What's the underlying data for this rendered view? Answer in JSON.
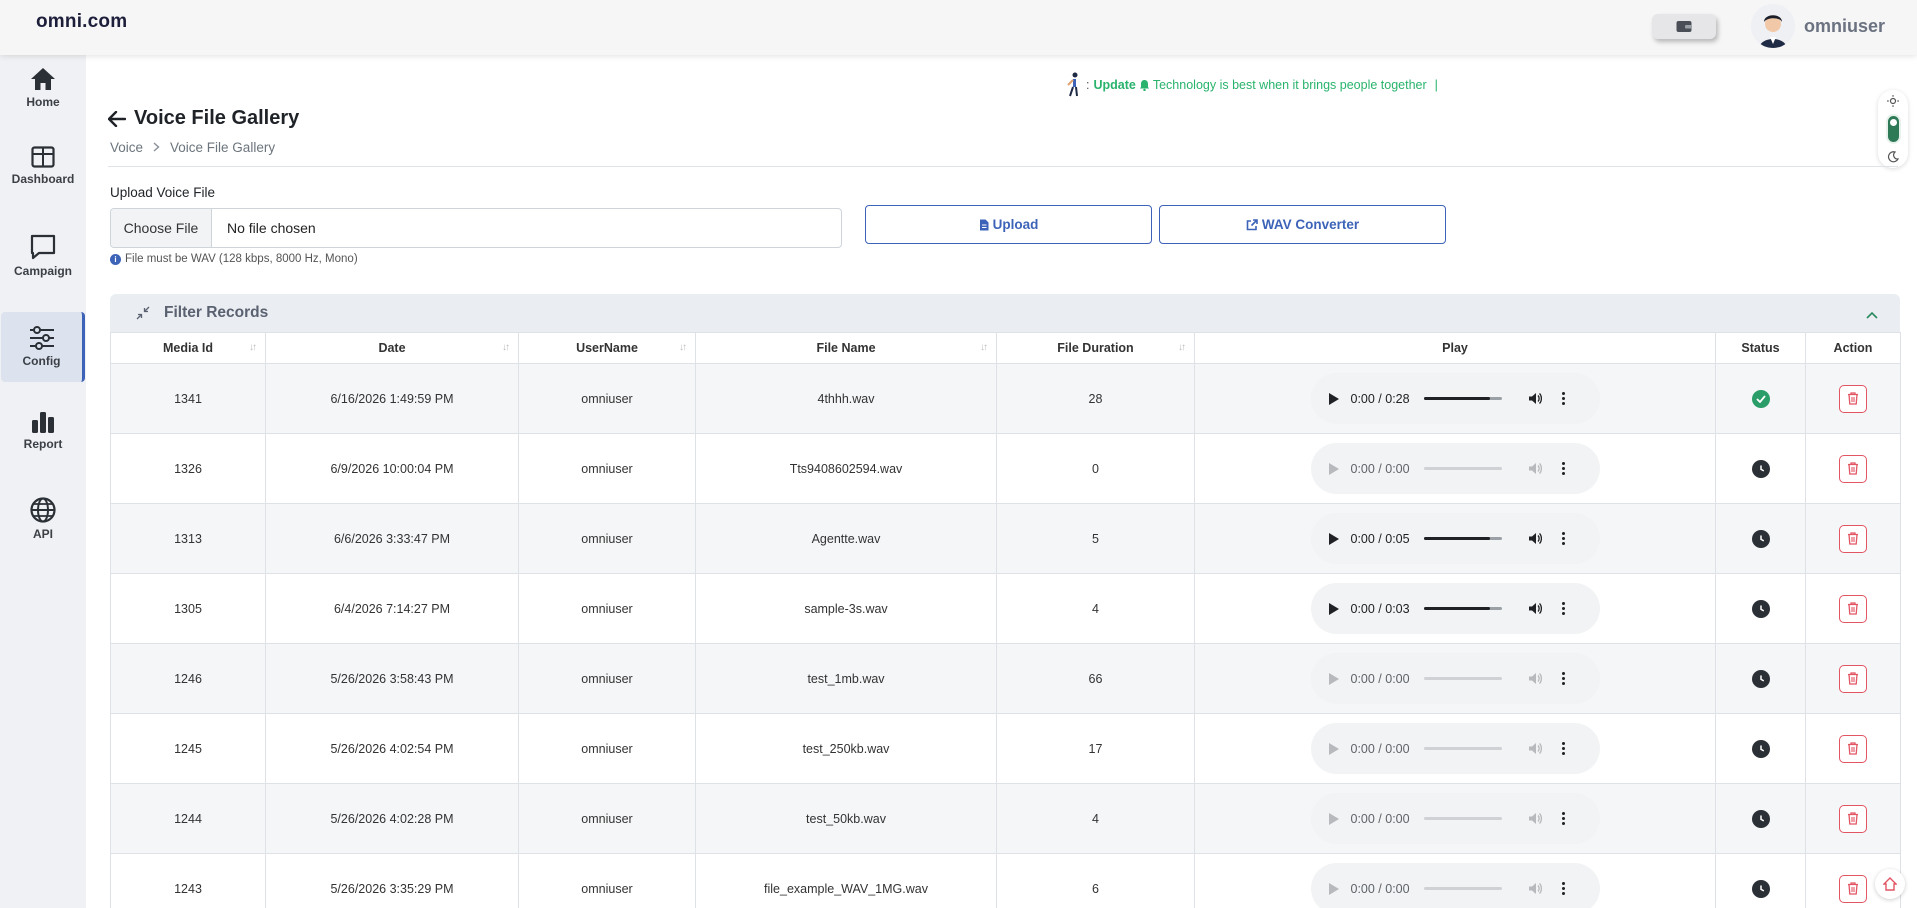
{
  "brand": "omni.com",
  "user": {
    "name": "omniuser"
  },
  "sidebar": {
    "items": [
      {
        "label": "Home",
        "icon": "home-icon"
      },
      {
        "label": "Dashboard",
        "icon": "dashboard-icon"
      },
      {
        "label": "Campaign",
        "icon": "campaign-icon"
      },
      {
        "label": "Config",
        "icon": "config-icon",
        "active": true
      },
      {
        "label": "Report",
        "icon": "report-icon"
      },
      {
        "label": "API",
        "icon": "globe-icon"
      }
    ]
  },
  "ticker": {
    "prefix": ":",
    "label": "Update",
    "message": "Technology is best when it brings people together"
  },
  "page": {
    "title": "Voice File Gallery",
    "breadcrumb": [
      "Voice",
      "Voice File Gallery"
    ]
  },
  "upload": {
    "label": "Upload Voice File",
    "choose_label": "Choose File",
    "file_status": "No file chosen",
    "hint": "File must be WAV (128 kbps, 8000 Hz, Mono)",
    "upload_button": "Upload",
    "converter_button": "WAV Converter"
  },
  "filter": {
    "title": "Filter Records"
  },
  "table": {
    "columns": [
      "Media Id",
      "Date",
      "UserName",
      "File Name",
      "File Duration",
      "Play",
      "Status",
      "Action"
    ],
    "rows": [
      {
        "media_id": "1341",
        "date": "6/16/2026 1:49:59 PM",
        "username": "omniuser",
        "file_name": "4thhh.wav",
        "duration": "28",
        "player_time": "0:00 / 0:28",
        "playable": true,
        "status": "approved"
      },
      {
        "media_id": "1326",
        "date": "6/9/2026 10:00:04 PM",
        "username": "omniuser",
        "file_name": "Tts9408602594.wav",
        "duration": "0",
        "player_time": "0:00 / 0:00",
        "playable": false,
        "status": "pending"
      },
      {
        "media_id": "1313",
        "date": "6/6/2026 3:33:47 PM",
        "username": "omniuser",
        "file_name": "Agentte.wav",
        "duration": "5",
        "player_time": "0:00 / 0:05",
        "playable": true,
        "status": "pending"
      },
      {
        "media_id": "1305",
        "date": "6/4/2026 7:14:27 PM",
        "username": "omniuser",
        "file_name": "sample-3s.wav",
        "duration": "4",
        "player_time": "0:00 / 0:03",
        "playable": true,
        "status": "pending"
      },
      {
        "media_id": "1246",
        "date": "5/26/2026 3:58:43 PM",
        "username": "omniuser",
        "file_name": "test_1mb.wav",
        "duration": "66",
        "player_time": "0:00 / 0:00",
        "playable": false,
        "status": "pending"
      },
      {
        "media_id": "1245",
        "date": "5/26/2026 4:02:54 PM",
        "username": "omniuser",
        "file_name": "test_250kb.wav",
        "duration": "17",
        "player_time": "0:00 / 0:00",
        "playable": false,
        "status": "pending"
      },
      {
        "media_id": "1244",
        "date": "5/26/2026 4:02:28 PM",
        "username": "omniuser",
        "file_name": "test_50kb.wav",
        "duration": "4",
        "player_time": "0:00 / 0:00",
        "playable": false,
        "status": "pending"
      },
      {
        "media_id": "1243",
        "date": "5/26/2026 3:35:29 PM",
        "username": "omniuser",
        "file_name": "file_example_WAV_1MG.wav",
        "duration": "6",
        "player_time": "0:00 / 0:00",
        "playable": false,
        "status": "pending"
      }
    ]
  },
  "colors": {
    "accent": "#3d63b8",
    "ticker_green": "#29b36c",
    "status_ok": "#2a9d68",
    "delete_red": "#e25563"
  }
}
